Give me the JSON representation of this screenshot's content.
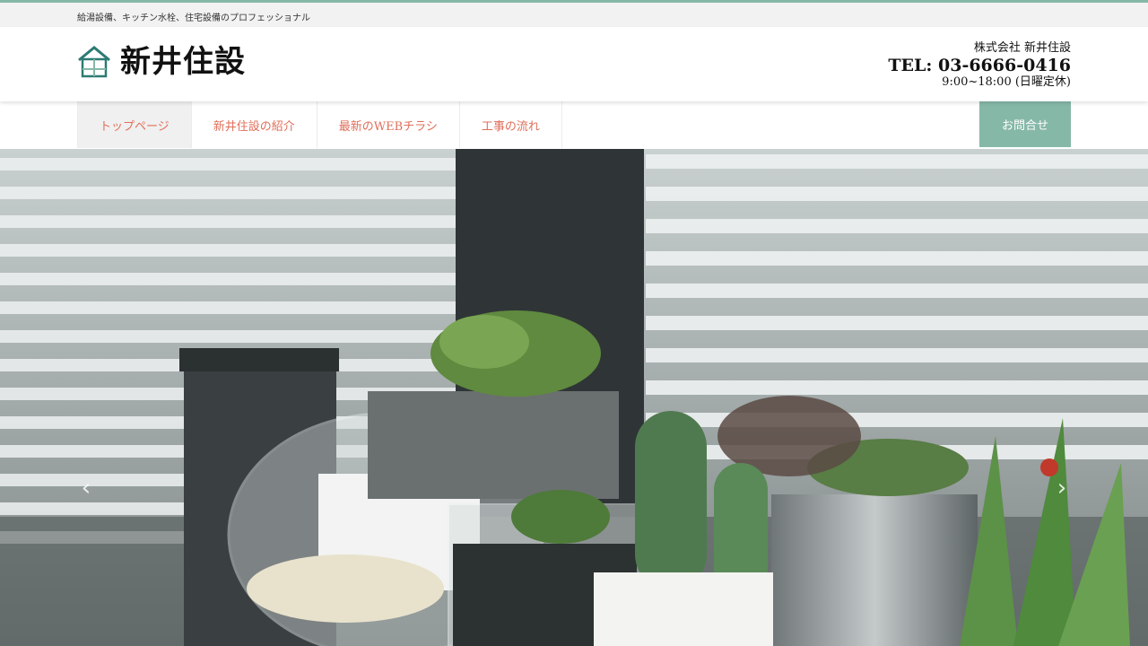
{
  "topbar": {
    "tagline": "給湯設備、キッチン水栓、住宅設備のプロフェッショナル"
  },
  "header": {
    "logo_text": "新井住設",
    "company_name": "株式会社 新井住設",
    "tel": "TEL: 03-6666-0416",
    "hours": "9:00~18:00 (日曜定休)"
  },
  "nav": {
    "items": [
      {
        "label": "トップページ",
        "active": true
      },
      {
        "label": "新井住設の紹介"
      },
      {
        "label": "最新のWEBチラシ"
      },
      {
        "label": "工事の流れ"
      }
    ],
    "cta_label": "お問合せ"
  },
  "hero": {
    "image": "cactus-and-succulents-by-window-blinds-photo",
    "prev_icon": "‹",
    "next_icon": "›"
  },
  "colors": {
    "accent": "#86b8a8",
    "nav_text": "#e06f5a",
    "topbar_bg": "#f2f2f2"
  }
}
